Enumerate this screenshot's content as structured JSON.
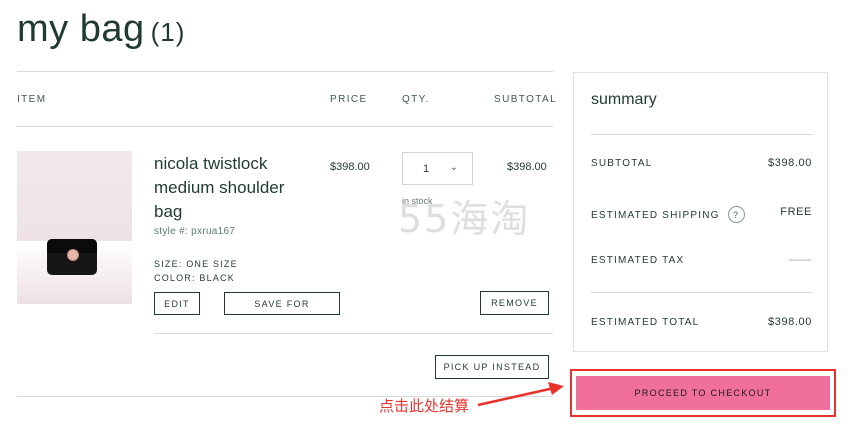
{
  "page": {
    "title": "my bag",
    "count": "(1)"
  },
  "cart": {
    "headers": {
      "item": "ITEM",
      "price": "PRICE",
      "qty": "QTY.",
      "subtotal": "SUBTOTAL"
    },
    "item": {
      "name": "nicola twistlock medium shoulder bag",
      "style": "style #: pxrua167",
      "size": "SIZE: ONE SIZE",
      "color": "COLOR: BLACK",
      "price": "$398.00",
      "qty": "1",
      "stock": "in stock",
      "subtotal": "$398.00"
    },
    "buttons": {
      "edit": "EDIT",
      "save_for": "SAVE FOR",
      "remove": "REMOVE",
      "pickup": "PICK UP INSTEAD"
    }
  },
  "summary": {
    "title": "summary",
    "subtotal_label": "SUBTOTAL",
    "subtotal_value": "$398.00",
    "shipping_label": "ESTIMATED SHIPPING",
    "shipping_info": "?",
    "shipping_value": "FREE",
    "tax_label": "ESTIMATED TAX",
    "tax_value": "——",
    "total_label": "ESTIMATED TOTAL",
    "total_value": "$398.00",
    "checkout_label": "PROCEED TO CHECKOUT"
  },
  "annotation": {
    "text": "点击此处结算",
    "color": "#e8332c"
  },
  "watermark": {
    "text": "55海淘"
  },
  "colors": {
    "text": "#1f3a2e",
    "checkout": "#f06f9b",
    "highlight": "#e8332c"
  }
}
